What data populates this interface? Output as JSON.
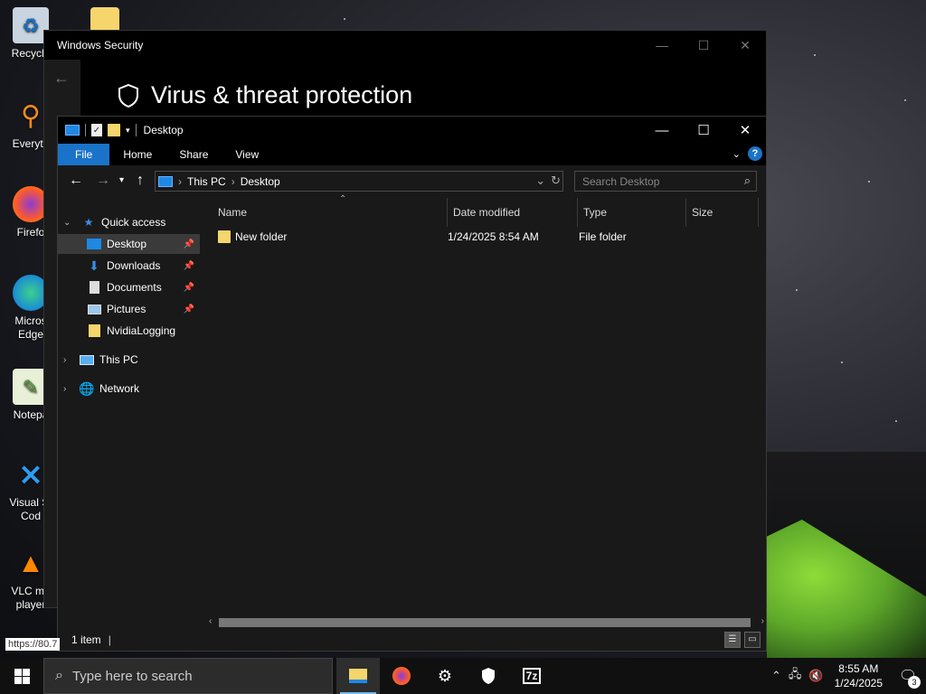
{
  "desktop": {
    "icons": [
      {
        "label": "Recycle",
        "icon": "recycle-bin-icon"
      },
      {
        "label": "Everyth",
        "icon": "everything-search-icon"
      },
      {
        "label": "Firefo",
        "icon": "firefox-icon"
      },
      {
        "label": "Micros Edge",
        "icon": "edge-icon"
      },
      {
        "label": "Notepa",
        "icon": "notepad-plus-plus-icon"
      },
      {
        "label": "Visual St Cod",
        "icon": "vscode-icon"
      },
      {
        "label": "VLC me player",
        "icon": "vlc-icon"
      }
    ],
    "url_tooltip": "https://80.7"
  },
  "security_window": {
    "title": "Windows Security",
    "heading": "Virus & threat protection"
  },
  "explorer": {
    "title": "Desktop",
    "ribbon_tabs": [
      "File",
      "Home",
      "Share",
      "View"
    ],
    "address": {
      "root": "This PC",
      "current": "Desktop"
    },
    "search_placeholder": "Search Desktop",
    "nav": {
      "quick_access": "Quick access",
      "items": [
        "Desktop",
        "Downloads",
        "Documents",
        "Pictures",
        "NvidiaLogging"
      ],
      "this_pc": "This PC",
      "network": "Network"
    },
    "columns": [
      "Name",
      "Date modified",
      "Type",
      "Size"
    ],
    "rows": [
      {
        "name": "New folder",
        "date": "1/24/2025 8:54 AM",
        "type": "File folder",
        "size": ""
      }
    ],
    "status": "1 item"
  },
  "taskbar": {
    "search_placeholder": "Type here to search",
    "time": "8:55 AM",
    "date": "1/24/2025",
    "notification_count": "3"
  },
  "colors": {
    "accent": "#1a73c9",
    "folder": "#f5d56c"
  }
}
